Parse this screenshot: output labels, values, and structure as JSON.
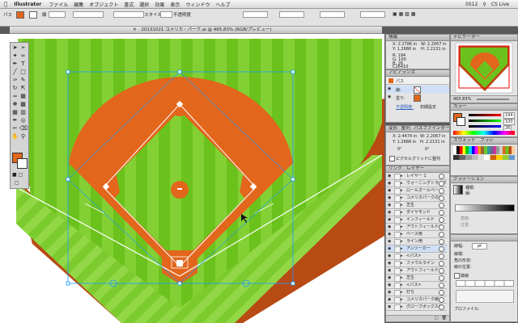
{
  "menubar": {
    "apple": "",
    "app": "Illustrator",
    "items": [
      "ファイル",
      "編集",
      "オブジェクト",
      "書式",
      "選択",
      "効果",
      "表示",
      "ウィンドウ",
      "ヘルプ"
    ],
    "right_value": "0512",
    "right_user": "CS Live"
  },
  "control": {
    "selection_label": "パス",
    "stroke_label": "線",
    "style_label": "スタイル",
    "opacity_label": "不透明度",
    "fill_color": "#e2661c"
  },
  "document": {
    "tab_title": "20131021 コメリカ・パーク.ai @ 465.83% (RGB/プレビュー)"
  },
  "info_panel": {
    "title": "情報",
    "x": "X: 2.2786 in",
    "y": "Y: 1.2686 in",
    "w": "W: 2.2067 in",
    "h": "H: 2.2131 in",
    "r": "R: 194",
    "g": "G: 100",
    "b": "B: 26",
    "hex": "C26410"
  },
  "appearance_panel": {
    "title": "アピアランス",
    "object": "パス",
    "stroke_row": "線:",
    "fill_row": "塗り:",
    "opacity_row": "不透明度:",
    "opacity_value": "初期設定"
  },
  "transform_panel": {
    "tabs": [
      "変形",
      "整列",
      "パスファインダー"
    ],
    "x": "X: 2.4474 in",
    "w": "W: 2.2067 in",
    "y": "Y: 1.2686 in",
    "h": "H: 2.2131 in",
    "angle": "0°",
    "shear": "0°",
    "checkbox_label": "ピクセルグリッドに整列"
  },
  "layers_panel": {
    "tabs": [
      "リンク",
      "レイヤー"
    ],
    "rows": [
      "レイヤー 1",
      "ウォーニングトラック",
      "ロールオールベー",
      "コメリカパークの内",
      "芝生",
      "ダイヤモンド",
      "インフィールド",
      "アウトフィールドの",
      "ベース用",
      "ライン用",
      "アンツーカー",
      "<パス>",
      "ファウルライン",
      "アウトフィールド",
      "芝生",
      "<パス>",
      "打ち",
      "コメリカパーク線",
      "グローブボックスの"
    ]
  },
  "navigator_panel": {
    "title": "ナビゲーター",
    "zoom": "465.83%"
  },
  "color_panel": {
    "title": "カラー",
    "r": "194",
    "g": "100",
    "b": "26",
    "hex": "C26410"
  },
  "swatches_panel": {
    "title": "スウォッチ",
    "tab2": "ブラシ"
  },
  "gradient_panel": {
    "title": "グラデーション",
    "type_label": "種類:",
    "stroke_label": "線:",
    "angle_label": "角度:",
    "location_label": "位置:"
  },
  "stroke_panel": {
    "weight_label": "線幅:",
    "weight_value": "pt",
    "cap_label": "線端:",
    "corner_label": "角の形状:",
    "align_label": "線の位置:",
    "dash_label": "破線",
    "profile_label": "プロファイル:"
  },
  "colors": {
    "grass": "#6cc21c",
    "grass_light": "#8cd63a",
    "clay": "#e2661c",
    "wall": "#b84a14",
    "selection": "#1a9aff"
  }
}
